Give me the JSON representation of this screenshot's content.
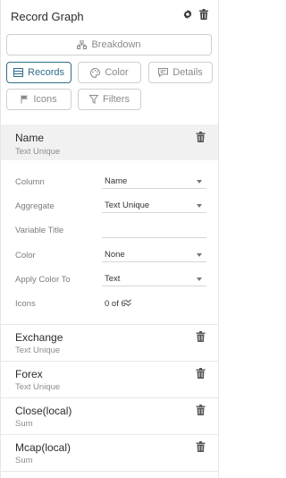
{
  "header": {
    "title": "Record Graph"
  },
  "buttons": {
    "breakdown": "Breakdown",
    "records": "Records",
    "color": "Color",
    "details": "Details",
    "icons": "Icons",
    "filters": "Filters"
  },
  "name_section": {
    "title": "Name",
    "subtitle": "Text Unique",
    "fields": {
      "column_label": "Column",
      "column_value": "Name",
      "aggregate_label": "Aggregate",
      "aggregate_value": "Text Unique",
      "variable_title_label": "Variable Title",
      "variable_title_value": "",
      "color_label": "Color",
      "color_value": "None",
      "apply_color_label": "Apply Color To",
      "apply_color_value": "Text",
      "icons_label": "Icons",
      "icons_value": "0 of 6"
    }
  },
  "records": [
    {
      "title": "Exchange",
      "subtitle": "Text Unique"
    },
    {
      "title": "Forex",
      "subtitle": "Text Unique"
    },
    {
      "title": "Close(local)",
      "subtitle": "Sum"
    },
    {
      "title": "Mcap(local)",
      "subtitle": "Sum"
    }
  ],
  "colors": {
    "accent": "#2e6e8c",
    "selected_bg": "#f1f1f1"
  }
}
